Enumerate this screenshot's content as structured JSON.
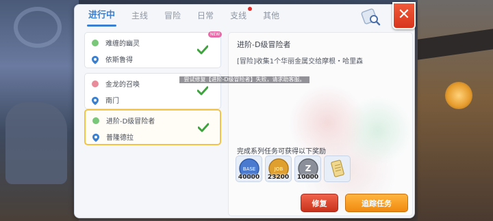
{
  "tabs": [
    {
      "label": "进行中",
      "active": true
    },
    {
      "label": "主线"
    },
    {
      "label": "冒险"
    },
    {
      "label": "日常"
    },
    {
      "label": "支线",
      "has_dot": true
    },
    {
      "label": "其他"
    }
  ],
  "close_label": "✕",
  "quests": [
    {
      "title": "难缠的幽灵",
      "location": "依斯鲁得",
      "completed": true,
      "is_new": true,
      "new_label": "NEW",
      "icon_color": "#7bc77a"
    },
    {
      "title": "金龙的召唤",
      "location": "南门",
      "completed": true,
      "icon_color": "#e88b9b"
    },
    {
      "title": "进阶-D级冒险者",
      "location": "普隆德拉",
      "completed": true,
      "selected": true,
      "icon_color": "#7bc77a"
    }
  ],
  "detail": {
    "title": "进阶-D级冒险者",
    "description": "[冒险]收集1个华丽金属交给摩根・哈里森",
    "reward_title": "完成系列任务可获得以下奖励",
    "rewards": [
      {
        "name": "base-exp",
        "value": "40000",
        "color": "#4a7ad0",
        "label": "BASE"
      },
      {
        "name": "job-exp",
        "value": "23200",
        "color": "#e0a030",
        "label": "JOB"
      },
      {
        "name": "zeny",
        "value": "10000",
        "color": "#8a8f99",
        "label": "Z"
      },
      {
        "name": "scroll",
        "value": "",
        "color": "#f0d890",
        "label": ""
      }
    ],
    "fix_button": "修复",
    "track_button": "追踪任务"
  },
  "toast": "尝试修复【进阶-D级冒险者】失败，请求助客服。"
}
